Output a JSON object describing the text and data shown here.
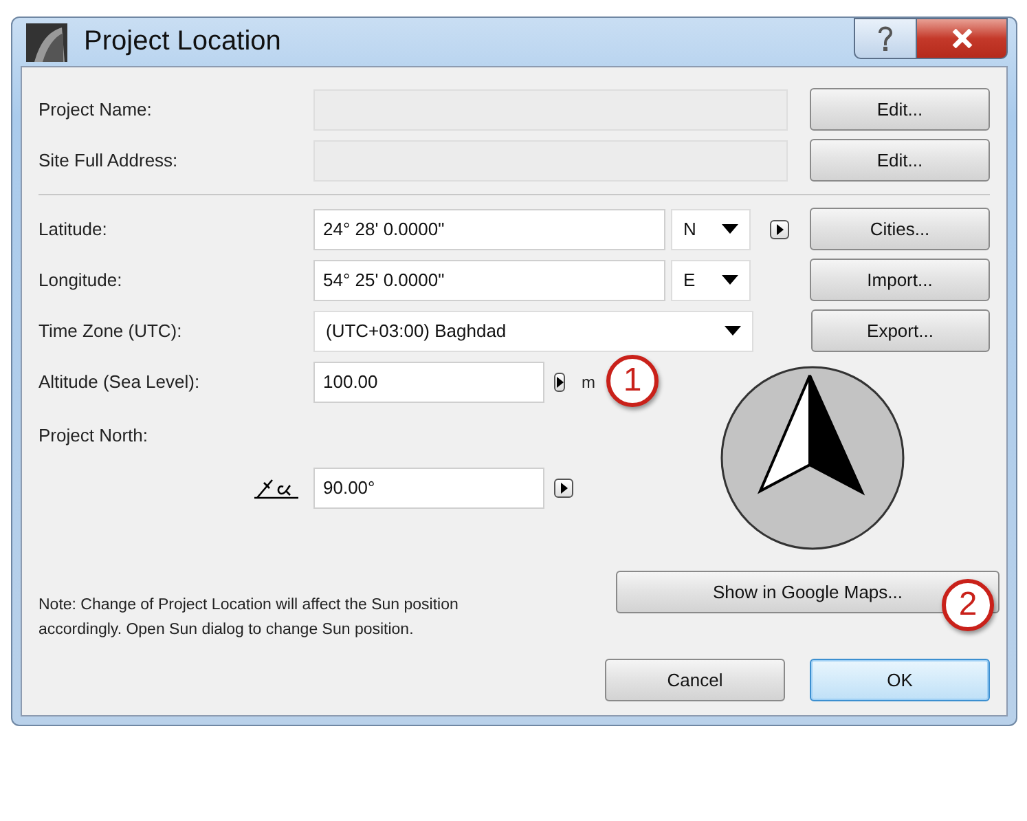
{
  "window": {
    "title": "Project Location"
  },
  "title_buttons": [
    {
      "kind": "help"
    },
    {
      "kind": "close"
    }
  ],
  "info_rows": [
    {
      "label": "Project Name:",
      "disabled": true,
      "button": "Edit..."
    },
    {
      "label": "Site Full Address:",
      "disabled": true,
      "button": "Edit..."
    }
  ],
  "location_rows": [
    {
      "label": "Latitude:",
      "value": "24° 28' 0.0000\"",
      "hemisphere": "N",
      "stepper": true,
      "button": "Cities..."
    },
    {
      "label": "Longitude:",
      "value": "54° 25' 0.0000\"",
      "hemisphere": "E",
      "stepper": false,
      "button": "Import..."
    }
  ],
  "time_zone": {
    "label": "Time Zone (UTC):",
    "value": "(UTC+03:00) Baghdad",
    "button": "Export..."
  },
  "altitude": {
    "label": "Altitude (Sea Level):",
    "value": "100.00",
    "unit": "m",
    "callout": "1"
  },
  "project_north": {
    "label": "Project North:",
    "value": "90.00°"
  },
  "note": "Note: Change of Project Location will affect the Sun position accordingly. Open Sun dialog to change Sun position.",
  "maps_button": {
    "label": "Show in Google Maps...",
    "callout": "2"
  },
  "buttons": [
    {
      "label": "Cancel",
      "default": false
    },
    {
      "label": "OK",
      "default": true
    }
  ]
}
